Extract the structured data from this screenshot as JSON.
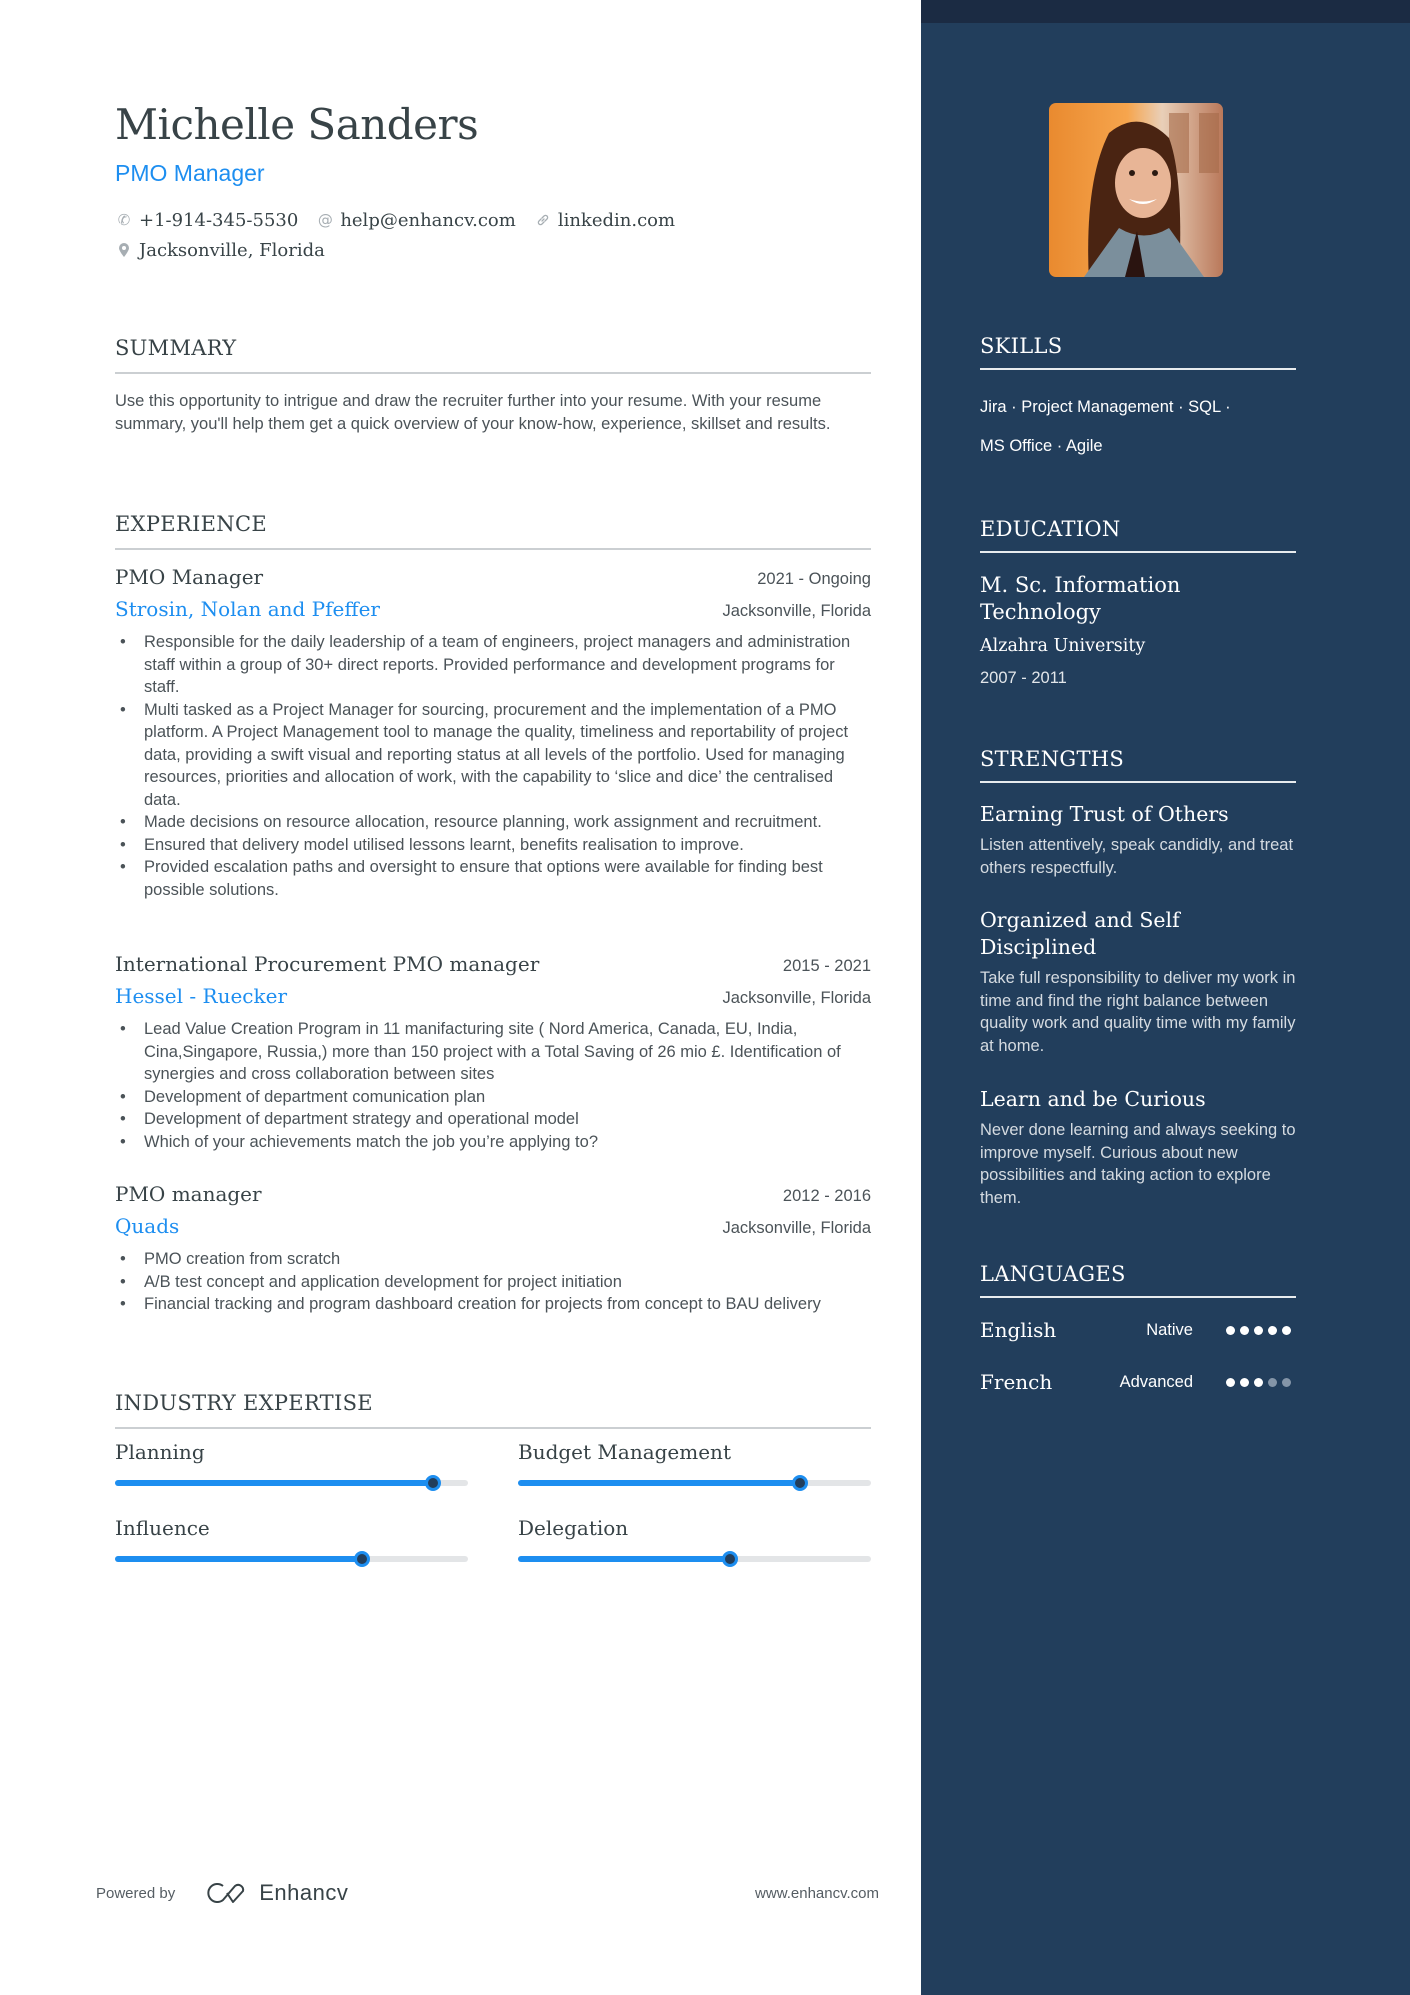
{
  "header": {
    "name": "Michelle Sanders",
    "title": "PMO Manager",
    "phone": "+1-914-345-5530",
    "email": "help@enhancv.com",
    "link": "linkedin.com",
    "location": "Jacksonville, Florida"
  },
  "summary": {
    "heading": "SUMMARY",
    "text": "Use this opportunity to intrigue and draw the recruiter further into your resume. With your resume summary, you'll help them get a quick overview of your know-how, experience, skillset and results."
  },
  "experience": {
    "heading": "EXPERIENCE",
    "jobs": [
      {
        "role": "PMO Manager",
        "dates": "2021 - Ongoing",
        "company": "Strosin, Nolan and Pfeffer",
        "location": "Jacksonville, Florida",
        "bullets": [
          "Responsible for the daily leadership of a team of engineers, project managers and administration staff within a group of 30+ direct reports. Provided performance and development programs for staff.",
          "Multi tasked as a Project Manager for sourcing, procurement and the implementation of a PMO platform.  A Project Management tool to manage the quality, timeliness and reportability of project data, providing a swift visual and reporting status at all levels of the portfolio. Used for managing resources, priorities and allocation of work, with the capability to ‘slice and dice’ the centralised data.",
          "Made decisions on resource allocation, resource planning, work assignment and recruitment.",
          "Ensured that delivery model utilised lessons learnt, benefits realisation to improve.",
          "Provided escalation paths and oversight to ensure that options were available for finding best possible solutions."
        ]
      },
      {
        "role": "International Procurement PMO manager",
        "dates": "2015 - 2021",
        "company": "Hessel - Ruecker",
        "location": "Jacksonville, Florida",
        "bullets": [
          "Lead Value Creation Program in 11 manifacturing site  ( Nord America,  Canada, EU, India, Cina,Singapore, Russia,) more than 150 project with a Total Saving of 26 mio £. Identification of synergies and cross collaboration between sites",
          "Development of department comunication plan",
          "Development of department strategy and operational model",
          "Which of your achievements match the job you’re applying to?"
        ]
      },
      {
        "role": "PMO manager",
        "dates": "2012 - 2016",
        "company": "Quads",
        "location": "Jacksonville, Florida",
        "bullets": [
          "PMO creation from scratch",
          "A/B test concept and application development for project initiation",
          "Financial tracking and program dashboard creation for projects from concept to BAU delivery"
        ]
      }
    ]
  },
  "expertise": {
    "heading": "INDUSTRY EXPERTISE",
    "items": [
      {
        "label": "Planning",
        "level": 0.9
      },
      {
        "label": "Budget Management",
        "level": 0.8
      },
      {
        "label": "Influence",
        "level": 0.7
      },
      {
        "label": "Delegation",
        "level": 0.6
      }
    ]
  },
  "footer": {
    "powered_by": "Powered by",
    "brand": "Enhancv",
    "website": "www.enhancv.com"
  },
  "sidebar": {
    "skills": {
      "heading": "SKILLS",
      "line1": "Jira · Project Management · SQL ·",
      "line2": "MS Office · Agile"
    },
    "education": {
      "heading": "EDUCATION",
      "degree": "M. Sc. Information Technology",
      "school": "Alzahra University",
      "years": "2007 - 2011"
    },
    "strengths": {
      "heading": "STRENGTHS",
      "items": [
        {
          "title": "Earning Trust of Others",
          "desc": "Listen attentively, speak candidly, and treat others respectfully."
        },
        {
          "title": "Organized and Self Disciplined",
          "desc": "Take full responsibility to deliver my work in time and find the right balance between quality work and quality time with my family at home."
        },
        {
          "title": "Learn and be Curious",
          "desc": "Never done learning and always seeking to improve myself. Curious about new possibilities and taking action to explore them."
        }
      ]
    },
    "languages": {
      "heading": "LANGUAGES",
      "items": [
        {
          "name": "English",
          "level": "Native",
          "dots": 5,
          "max": 5
        },
        {
          "name": "French",
          "level": "Advanced",
          "dots": 3,
          "max": 5
        }
      ]
    }
  },
  "colors": {
    "accent": "#1d8ef0",
    "sidebar": "#223e5c",
    "sidebar_top": "#1b2b43",
    "text": "#384347"
  }
}
